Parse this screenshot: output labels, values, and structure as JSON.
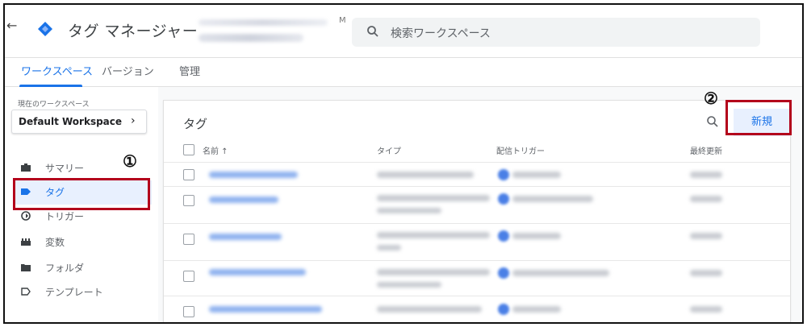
{
  "header": {
    "back_icon": "arrow-back-icon",
    "app_title": "タグ マネージャー",
    "account_suffix": "M",
    "search_placeholder": "検索ワークスペース",
    "logo_color": "#1a73e8"
  },
  "tabs": [
    {
      "label": "ワークスペース",
      "active": true
    },
    {
      "label": "バージョン",
      "active": false
    },
    {
      "label": "管理",
      "active": false
    }
  ],
  "sidebar": {
    "workspace_label": "現在のワークスペース",
    "workspace_name": "Default Workspace",
    "workspace_chevron": "›",
    "items": [
      {
        "label": "サマリー",
        "icon": "briefcase-icon",
        "active": false
      },
      {
        "label": "タグ",
        "icon": "tag-icon",
        "active": true
      },
      {
        "label": "トリガー",
        "icon": "trigger-icon",
        "active": false
      },
      {
        "label": "変数",
        "icon": "blocks-icon",
        "active": false
      },
      {
        "label": "フォルダ",
        "icon": "folder-icon",
        "active": false
      },
      {
        "label": "テンプレート",
        "icon": "template-icon",
        "active": false
      }
    ]
  },
  "annotations": {
    "marker1": "①",
    "marker2": "②",
    "highlight_color": "#b3001b"
  },
  "main": {
    "card_title": "タグ",
    "new_button": "新規",
    "columns": {
      "name": "名前 ↑",
      "type": "タイプ",
      "trigger": "配信トリガー",
      "updated": "最終更新"
    }
  },
  "colors": {
    "accent": "#1a73e8",
    "active_bg": "#e8f0fe"
  }
}
